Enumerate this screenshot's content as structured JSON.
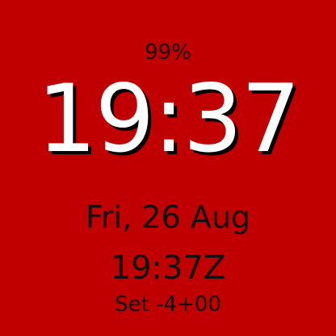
{
  "watchface": {
    "background_color": "#c00000",
    "battery_text": "99%",
    "time_text": "19:37",
    "date_text": "Fri, 26 Aug",
    "utc_time_text": "19:37Z",
    "set_text": "Set -4+00"
  }
}
